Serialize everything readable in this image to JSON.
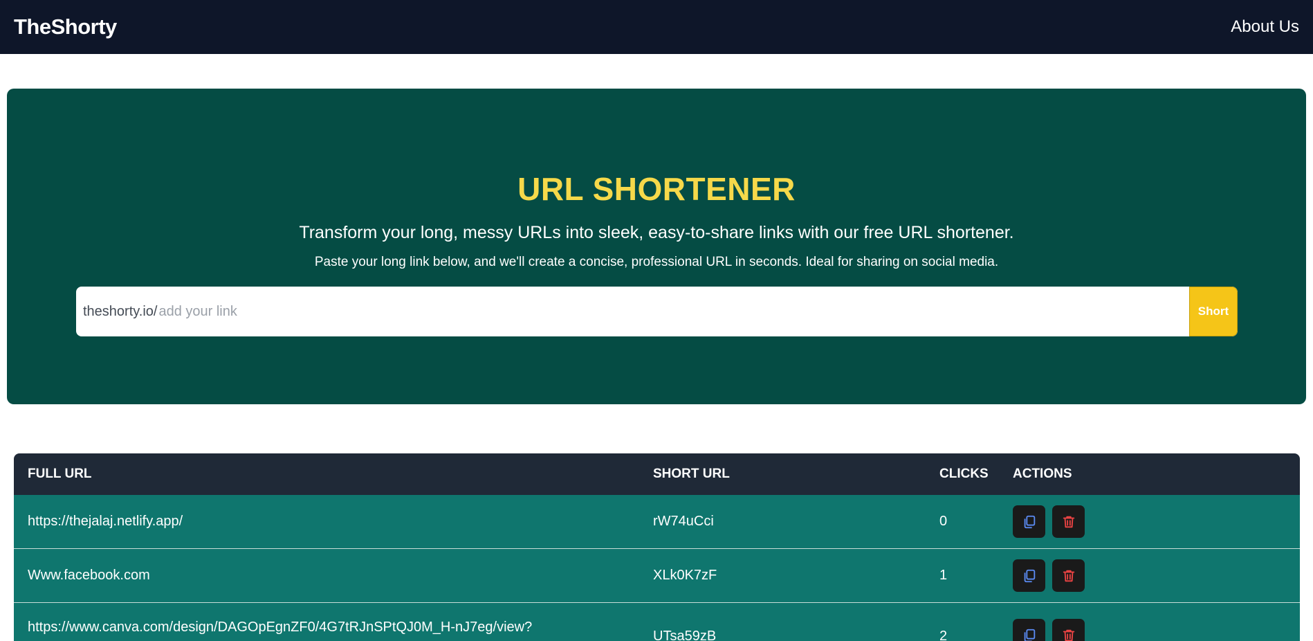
{
  "navbar": {
    "brand": "TheShorty",
    "about_label": "About Us"
  },
  "hero": {
    "title": "URL SHORTENER",
    "subtitle": "Transform your long, messy URLs into sleek, easy-to-share links with our free URL shortener.",
    "description": "Paste your long link below, and we'll create a concise, professional URL in seconds. Ideal for sharing on social media.",
    "input": {
      "prefix": "theshorty.io/",
      "placeholder": "add your link",
      "value": ""
    },
    "button_label": "Short"
  },
  "table": {
    "headers": [
      "FULL URL",
      "SHORT URL",
      "CLICKS",
      "ACTIONS"
    ],
    "rows": [
      {
        "full_url": "https://thejalaj.netlify.app/",
        "short_url": "rW74uCci",
        "clicks": "0"
      },
      {
        "full_url": "Www.facebook.com",
        "short_url": "XLk0K7zF",
        "clicks": "1"
      },
      {
        "full_url": "https://www.canva.com/design/DAGOpEgnZF0/4G7tRJnSPtQJ0M_H-nJ7eg/view?",
        "short_url": "UTsa59zB",
        "clicks": "2"
      }
    ],
    "actions": {
      "copy_icon": "copy-icon",
      "delete_icon": "trash-icon"
    }
  },
  "colors": {
    "navbar_bg": "#0e1629",
    "hero_bg": "#054c44",
    "title": "#f6d94a",
    "button": "#f5c518",
    "table_header": "#1f2937",
    "row_bg": "#0f766e",
    "copy_icon": "#5b8cf5",
    "delete_icon": "#ef4444"
  }
}
